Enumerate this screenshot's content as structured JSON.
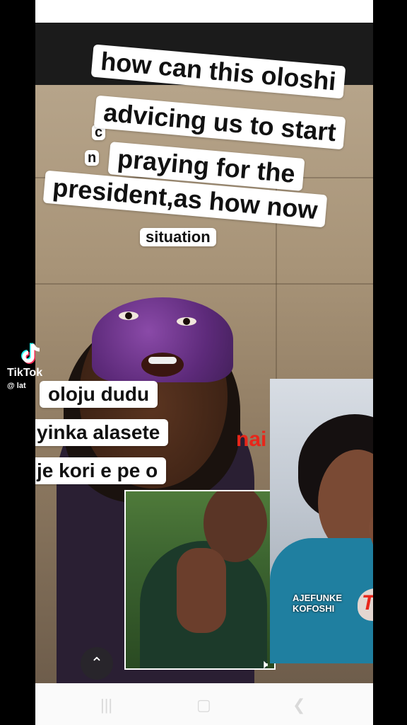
{
  "captions": {
    "top_lines": [
      "how can this oloshi",
      "advicing us to start",
      "praying for the",
      "president,as how now"
    ],
    "hidden_fragments": [
      "c",
      "n",
      "situation"
    ],
    "middle_lines": [
      "oloju dudu",
      "yinka alasete",
      "je kori e pe o"
    ],
    "red_fragment": "nai"
  },
  "tiktok": {
    "brand": "TikTok",
    "handle": "@ lat"
  },
  "inset_right": {
    "brand_line1": "AJEFUNKE",
    "brand_line2": "KOFOSHI",
    "brand_tv": "TV"
  },
  "controls": {
    "scroll_up_icon": "chevron-up-icon",
    "mute_icon": "speaker-icon",
    "nav_icons": [
      "recent-apps-icon",
      "home-icon",
      "back-icon"
    ]
  },
  "colors": {
    "caption_bg": "#ffffff",
    "red_text": "#e8261a",
    "turban": "#5d2a7a"
  }
}
